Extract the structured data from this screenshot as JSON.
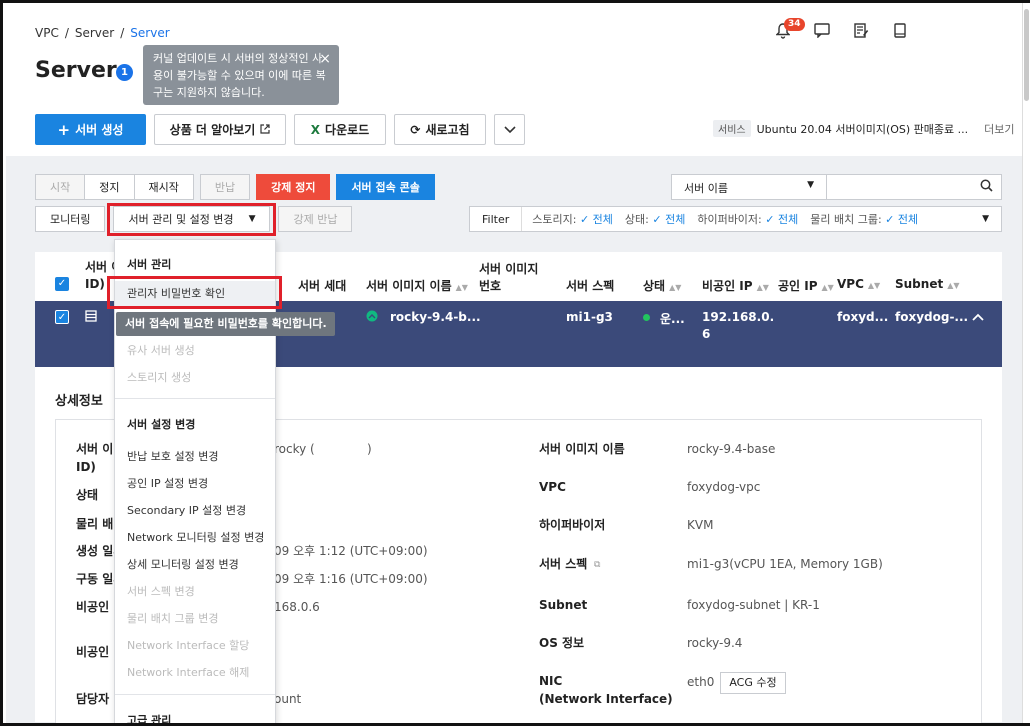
{
  "breadcrumb": {
    "items": [
      "VPC",
      "Server",
      "Server"
    ]
  },
  "header": {
    "title": "Server",
    "info_count": "1",
    "notification_count": "34"
  },
  "tooltip": {
    "text": "커널 업데이트 시 서버의 정상적인 사용이 불가능할 수 있으며 이에 따른 복구는 지원하지 않습니다.",
    "close": "×"
  },
  "toolbar": {
    "create": "서버 생성",
    "learn": "상품 더 알아보기",
    "download": "다운로드",
    "refresh": "새로고침"
  },
  "notice": {
    "tag": "서비스",
    "text": "Ubuntu 20.04 서버이미지(OS) 판매종료 ...",
    "more": "더보기"
  },
  "actions": {
    "start": "시작",
    "stop": "정지",
    "restart": "재시작",
    "return": "반납",
    "force_stop": "강제 정지",
    "console": "서버 접속 콘솔",
    "monitor": "모니터링",
    "manage": "서버 관리 및 설정 변경",
    "force_return": "강제 반납"
  },
  "search": {
    "select": "서버 이름"
  },
  "filter": {
    "label": "Filter",
    "storage": "스토리지:",
    "storage_val": "전체",
    "status": "상태:",
    "status_val": "전체",
    "hypervisor": "하이퍼바이저:",
    "hypervisor_val": "전체",
    "placement": "물리 배치 그룹:",
    "placement_val": "전체"
  },
  "table": {
    "headers": {
      "id": "ID)",
      "id_top": "서버 이",
      "gen": "서버 세대",
      "image": "서버 이미지 이름",
      "image_no_1": "서버 이미지",
      "image_no_2": "번호",
      "spec": "서버 스펙",
      "status": "상태",
      "private_ip": "비공인 IP",
      "public_ip": "공인 IP",
      "vpc": "VPC",
      "subnet": "Subnet"
    },
    "row": {
      "image": "rocky-9.4-b...",
      "spec": "mi1-g3",
      "status": "운...",
      "ip_1": "192.168.0.",
      "ip_2": "6",
      "vpc": "foxyd...",
      "subnet": "foxydog-..."
    }
  },
  "details": {
    "title": "상세정보",
    "left": {
      "server_name_label_1": "서버 이",
      "server_name_label_2": "ID)",
      "server_name_value": "rocky (",
      "server_name_paren": ")",
      "status_label": "상태",
      "placement_label": "물리 배",
      "created_label": "생성 일시",
      "created_value": "09 오후 1:12 (UTC+09:00)",
      "running_label": "구동 일시",
      "running_value": "09 오후 1:16 (UTC+09:00)",
      "private_ip_label": "비공인 I",
      "private_ip_value": "168.0.6",
      "private_dns_label": "비공인 S",
      "owner_label": "담당자",
      "owner_value": "ount"
    },
    "right": {
      "image_label": "서버 이미지 이름",
      "image_value": "rocky-9.4-base",
      "vpc_label": "VPC",
      "vpc_value": "foxydog-vpc",
      "hyper_label": "하이퍼바이저",
      "hyper_value": "KVM",
      "spec_label": "서버 스펙",
      "spec_value": "mi1-g3(vCPU 1EA, Memory 1GB)",
      "subnet_label": "Subnet",
      "subnet_value": "foxydog-subnet | KR-1",
      "os_label": "OS 정보",
      "os_value": "rocky-9.4",
      "nic_label_1": "NIC",
      "nic_label_2": "(Network Interface)",
      "nic_value": "eth0",
      "acg": "ACG 수정"
    }
  },
  "dropdown": {
    "section1": "서버 관리",
    "pw_check": "관리자 비밀번호 확인",
    "pw_tip": "서버 접속에 필요한 비밀번호를 확인합니다.",
    "similar": "유사 서버 생성",
    "storage": "스토리지 생성",
    "section2": "서버 설정 변경",
    "return_protect": "반납 보호 설정 변경",
    "public_ip": "공인 IP 설정 변경",
    "secondary_ip": "Secondary IP 설정 변경",
    "net_monitor": "Network 모니터링 설정 변경",
    "detail_monitor": "상세 모니터링 설정 변경",
    "spec_change": "서버 스펙 변경",
    "placement_change": "물리 배치 그룹 변경",
    "nic_assign": "Network Interface 할당",
    "nic_release": "Network Interface 해제",
    "section3": "고급 관리"
  }
}
